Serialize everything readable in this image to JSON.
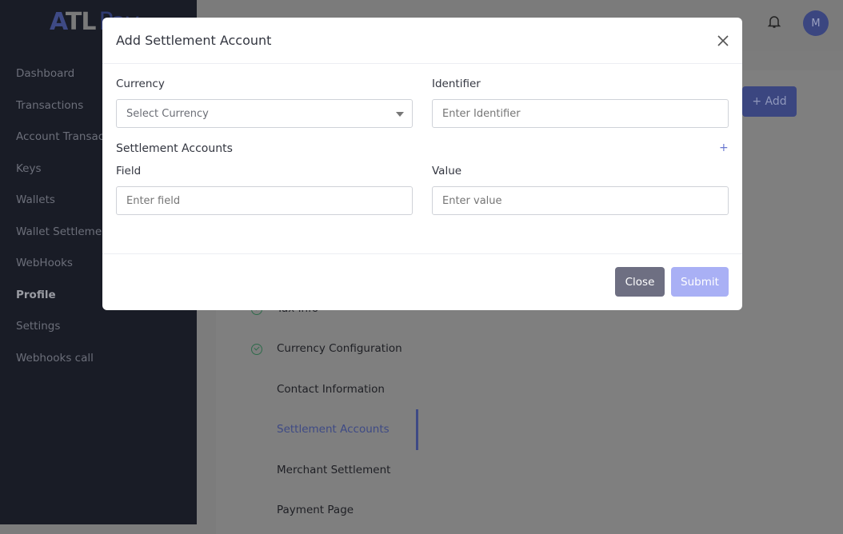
{
  "logo": {
    "text": "ATL",
    "suffix": "Pay"
  },
  "sidebar": {
    "items": [
      {
        "label": "Dashboard"
      },
      {
        "label": "Transactions"
      },
      {
        "label": "Account Transactions"
      },
      {
        "label": "Keys"
      },
      {
        "label": "Wallets"
      },
      {
        "label": "Wallet Settlement"
      },
      {
        "label": "WebHooks"
      },
      {
        "label": "Profile",
        "active": true
      },
      {
        "label": "Settings"
      },
      {
        "label": "Webhooks call"
      }
    ]
  },
  "header": {
    "avatar_initial": "M",
    "bell": "bell-icon"
  },
  "page": {
    "add_label": "+ Add"
  },
  "steps": [
    {
      "label": "Tax Info",
      "done": true
    },
    {
      "label": "Currency Configuration",
      "done": true
    },
    {
      "label": "Contact Information"
    },
    {
      "label": "Settlement Accounts",
      "current": true
    },
    {
      "label": "Merchant Settlement"
    },
    {
      "label": "Payment Page"
    }
  ],
  "modal": {
    "title": "Add Settlement Account",
    "currency_label": "Currency",
    "currency_placeholder": "Select Currency",
    "identifier_label": "Identifier",
    "identifier_placeholder": "Enter Identifier",
    "section_title": "Settlement Accounts",
    "add_icon": "+",
    "field_label": "Field",
    "field_placeholder": "Enter field",
    "value_label": "Value",
    "value_placeholder": "Enter value",
    "close_label": "Close",
    "submit_label": "Submit"
  },
  "colors": {
    "accent": "#3e4a85",
    "submit": "#a9b0f5",
    "close": "#6e6f82"
  }
}
